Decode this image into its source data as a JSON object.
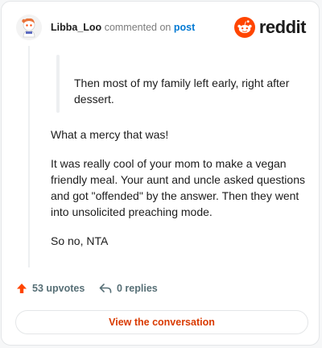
{
  "header": {
    "username": "Libba_Loo",
    "commented_on": "commented on",
    "post_link": "post",
    "brand_wordmark": "reddit"
  },
  "comment": {
    "quote": "Then most of my family left early, right after dessert.",
    "paragraphs": [
      "What a mercy that was!",
      "It was really cool of your mom to make a vegan friendly meal. Your aunt and uncle asked questions and got \"offended\" by the answer. Then they went into unsolicited preaching mode.",
      "So no, NTA"
    ]
  },
  "actions": {
    "upvotes": "53 upvotes",
    "replies": "0 replies"
  },
  "cta": {
    "label": "View the conversation"
  },
  "icons": {
    "avatar": "snoo-avatar-icon",
    "brand": "reddit-logo-icon",
    "upvote": "upvote-arrow-icon",
    "reply": "reply-arrow-icon"
  },
  "colors": {
    "brand_orange": "#ff4500",
    "link_blue": "#0079d3",
    "cta_text": "#d93a00",
    "muted": "#576f76"
  }
}
